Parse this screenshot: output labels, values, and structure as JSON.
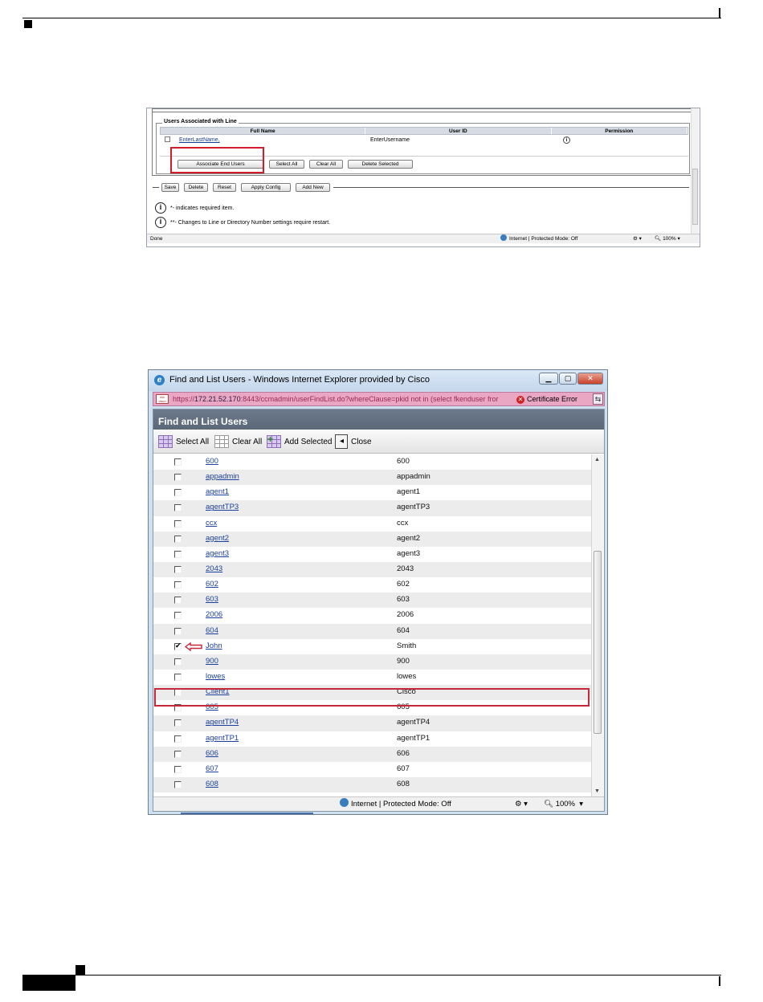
{
  "screenshot1": {
    "legend": "Users Associated with Line",
    "table": {
      "headers": [
        "Full Name",
        "User ID",
        "Permission"
      ],
      "row": {
        "full_name": "EnterLastName,",
        "user_id": "EnterUsername"
      }
    },
    "buttons": [
      "Associate End Users",
      "Select All",
      "Clear All",
      "Delete Selected"
    ],
    "action_buttons": [
      "Save",
      "Delete",
      "Reset",
      "Apply Config",
      "Add New"
    ],
    "notes": [
      "*- indicates required item.",
      "**- Changes to Line or Directory Number settings require restart."
    ],
    "status": {
      "left": "Done",
      "zone": "Internet | Protected Mode: Off",
      "zoom": "100%"
    }
  },
  "screenshot2": {
    "window_title": "Find and List Users - Windows Internet Explorer provided by Cisco",
    "url": {
      "prefix": "https://",
      "host": "172.21.52.170",
      "rest": ":8443/ccmadmin/userFindList.do?whereClause=pkid not in (select fkenduser fror"
    },
    "cert_error": "Certificate Error",
    "page_title": "Find and List Users",
    "toolbar": {
      "select_all": "Select All",
      "clear_all": "Clear All",
      "add_selected": "Add Selected",
      "close": "Close"
    },
    "rows": [
      {
        "name": "600",
        "uid": "600",
        "checked": false
      },
      {
        "name": "appadmin",
        "uid": "appadmin",
        "checked": false
      },
      {
        "name": "agent1",
        "uid": "agent1",
        "checked": false
      },
      {
        "name": "agentTP3",
        "uid": "agentTP3",
        "checked": false
      },
      {
        "name": "ccx",
        "uid": "ccx",
        "checked": false
      },
      {
        "name": "agent2",
        "uid": "agent2",
        "checked": false
      },
      {
        "name": "agent3",
        "uid": "agent3",
        "checked": false
      },
      {
        "name": "2043",
        "uid": "2043",
        "checked": false
      },
      {
        "name": "602",
        "uid": "602",
        "checked": false
      },
      {
        "name": "603",
        "uid": "603",
        "checked": false
      },
      {
        "name": "2006",
        "uid": "2006",
        "checked": false
      },
      {
        "name": "604",
        "uid": "604",
        "checked": false
      },
      {
        "name": "John",
        "uid": "Smith",
        "checked": true
      },
      {
        "name": "900",
        "uid": "900",
        "checked": false
      },
      {
        "name": "lowes",
        "uid": "lowes",
        "checked": false
      },
      {
        "name": "Client1",
        "uid": "Cisco",
        "checked": false
      },
      {
        "name": "605",
        "uid": "605",
        "checked": false
      },
      {
        "name": "agentTP4",
        "uid": "agentTP4",
        "checked": false
      },
      {
        "name": "agentTP1",
        "uid": "agentTP1",
        "checked": false
      },
      {
        "name": "606",
        "uid": "606",
        "checked": false
      },
      {
        "name": "607",
        "uid": "607",
        "checked": false
      },
      {
        "name": "608",
        "uid": "608",
        "checked": false
      }
    ],
    "status": {
      "zone": "Internet | Protected Mode: Off",
      "zoom": "100%"
    }
  },
  "colors": {
    "highlight": "#d11d2a",
    "link": "#1b3f9c",
    "header_bg": "#6d7a8b",
    "urlbar_bg": "#e9a7c4"
  }
}
